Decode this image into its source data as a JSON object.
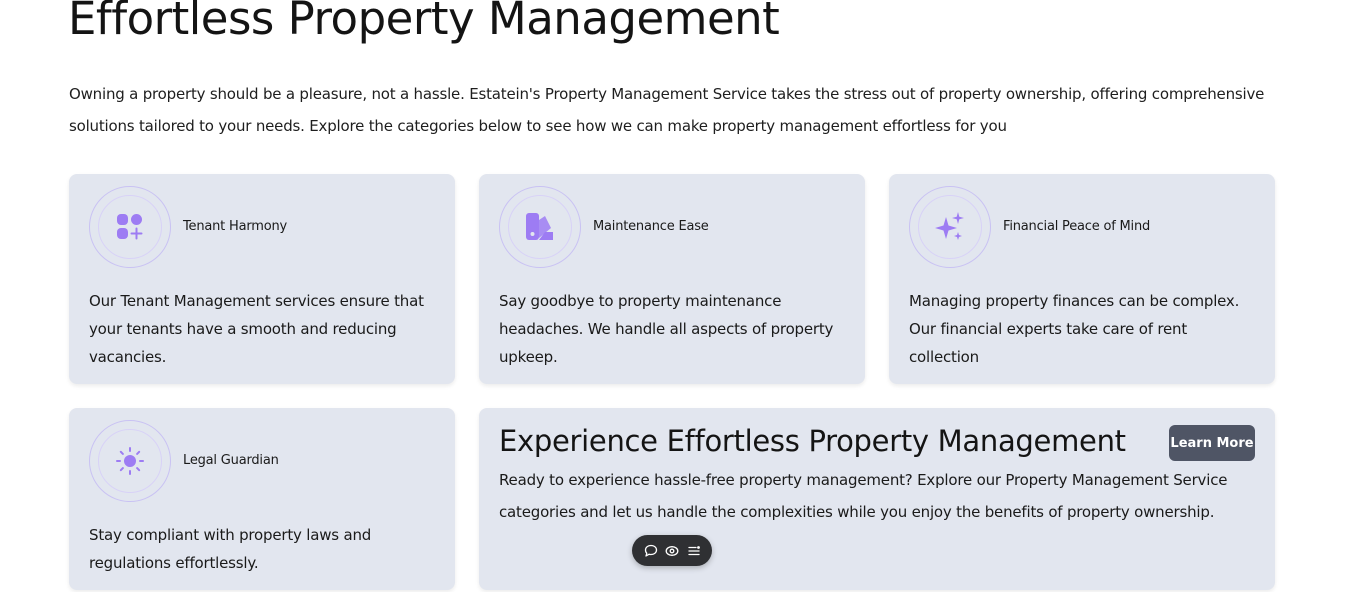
{
  "header": {
    "title": "Effortless Property Management",
    "intro": "Owning a property should be a pleasure, not a hassle. Estatein's Property Management Service takes the stress out of property ownership, offering comprehensive solutions tailored to your needs. Explore the categories below to see how we can make property management effortless for you"
  },
  "cards": [
    {
      "title": "Tenant Harmony",
      "icon": "apps-add-icon",
      "description": "Our Tenant Management services ensure that your tenants have a smooth and reducing vacancies."
    },
    {
      "title": "Maintenance Ease",
      "icon": "palette-icon",
      "description": "Say goodbye to property maintenance headaches. We handle all aspects of property upkeep."
    },
    {
      "title": "Financial Peace of Mind",
      "icon": "sparkles-icon",
      "description": "Managing property finances can be complex. Our financial experts take care of rent collection"
    },
    {
      "title": "Legal Guardian",
      "icon": "sun-icon",
      "description": "Stay compliant with property laws and regulations effortlessly."
    }
  ],
  "cta": {
    "title": "Experience Effortless Property Management",
    "description": "Ready to experience hassle-free property management? Explore our Property Management Service categories and let us handle the complexities while you enjoy the benefits of property ownership.",
    "button_label": "Learn More"
  },
  "toolbar": {
    "icons": [
      "comment-icon",
      "eye-icon",
      "menu-icon"
    ]
  },
  "colors": {
    "accent": "#9d7cf3",
    "card_bg": "#e2e6ef",
    "button_bg": "#4f5565"
  }
}
